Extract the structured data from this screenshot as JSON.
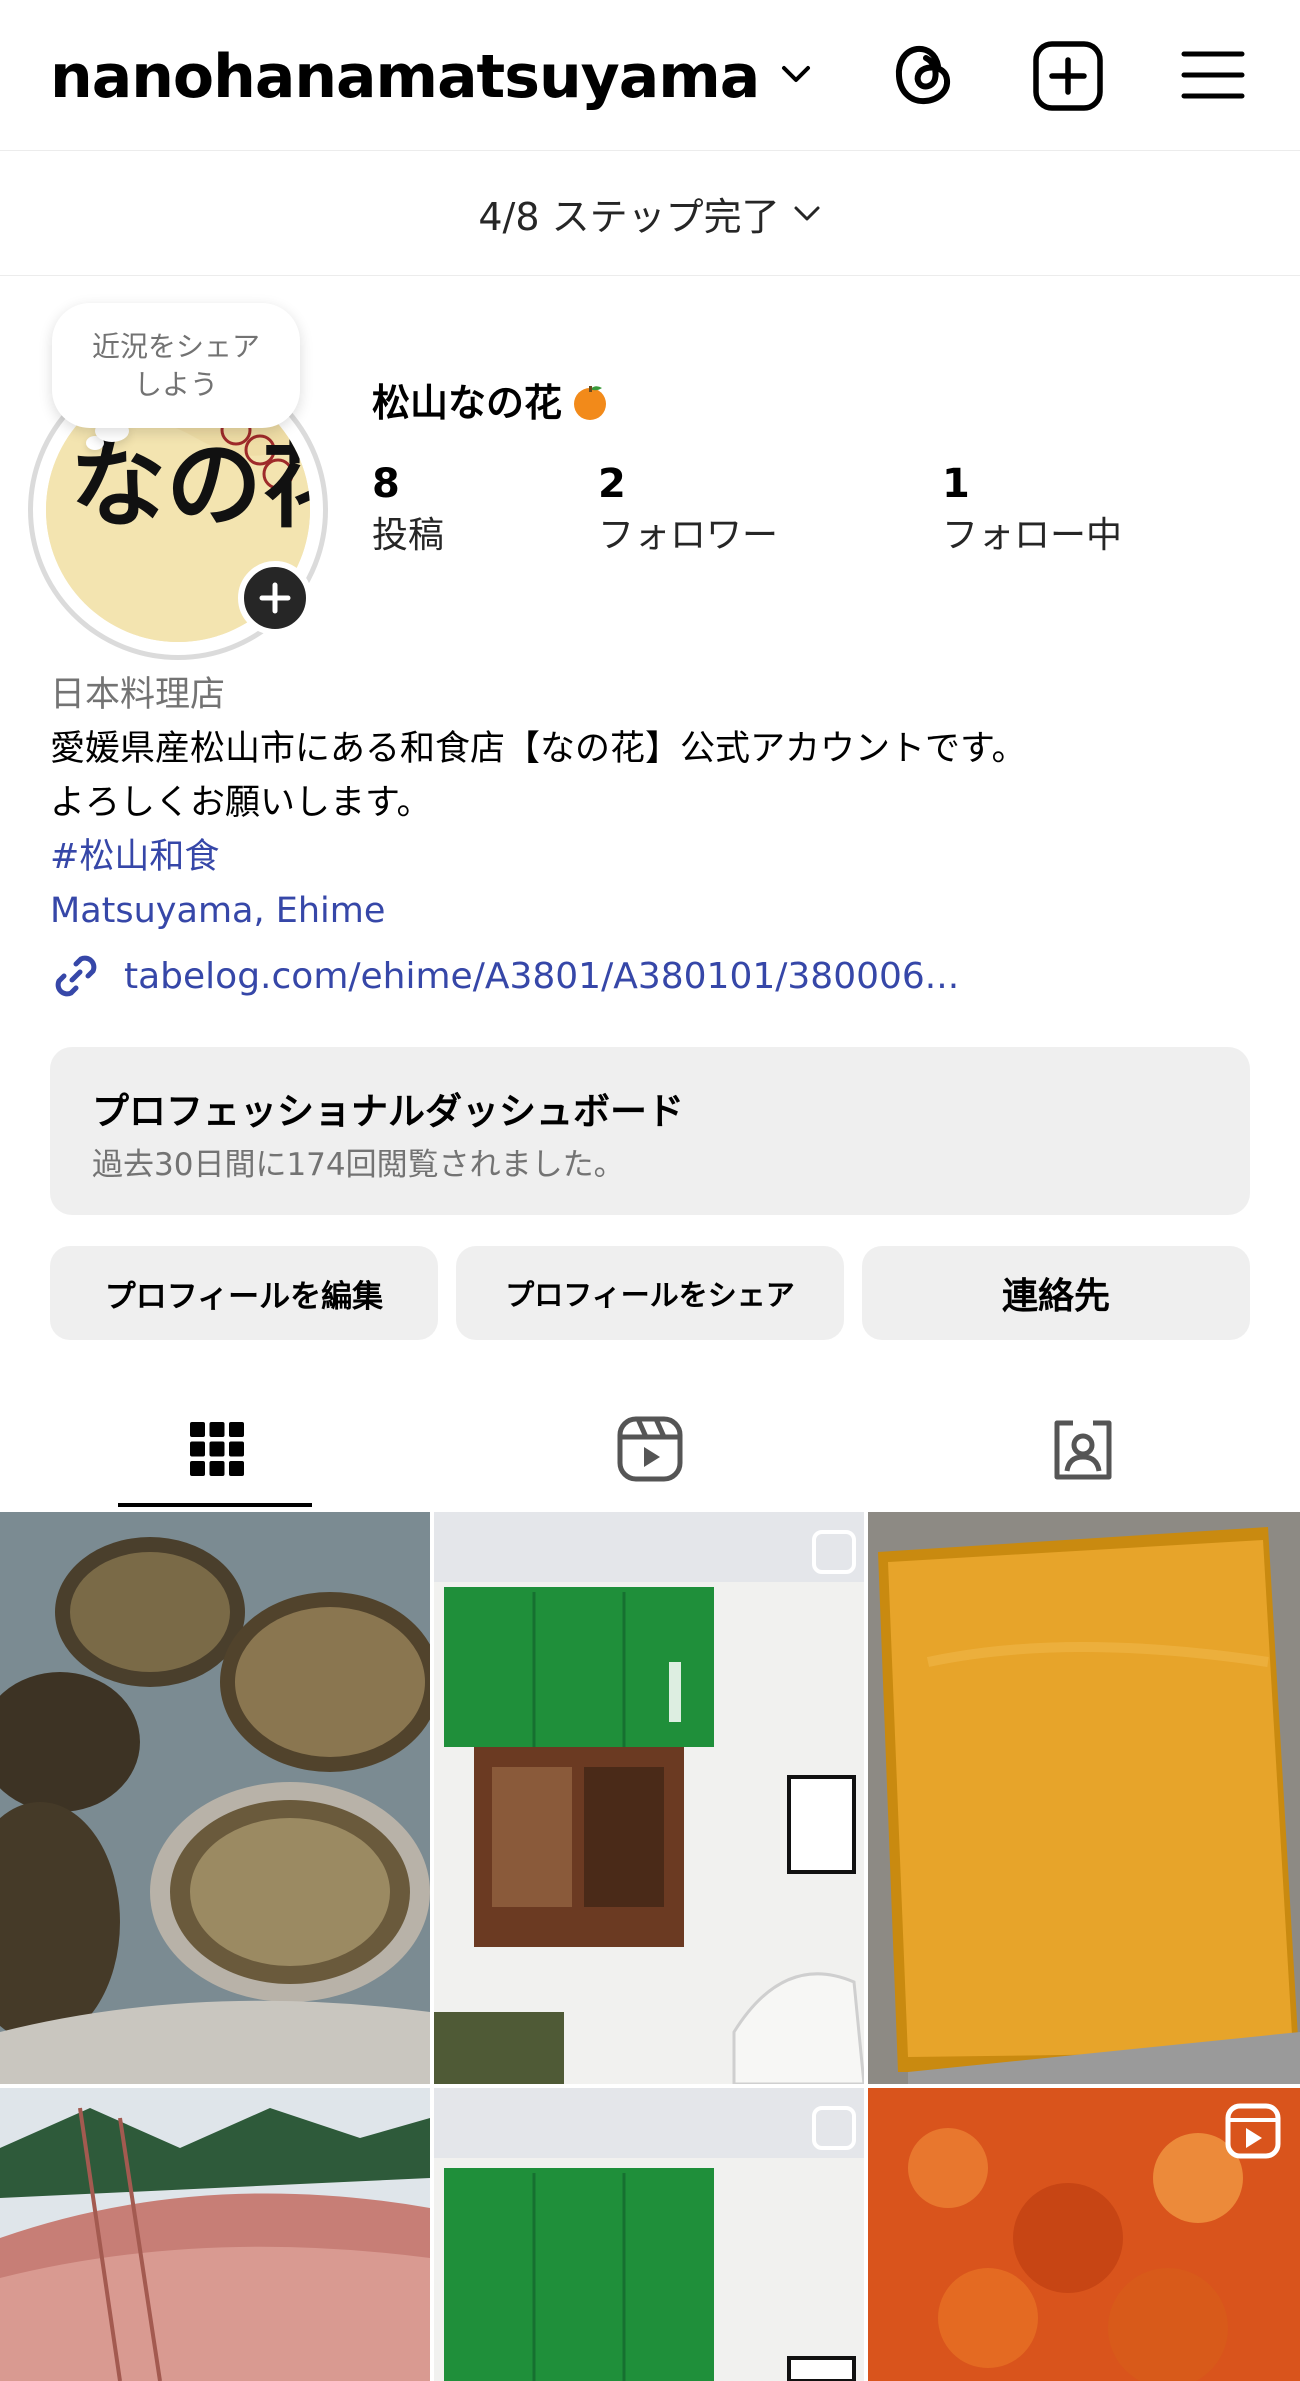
{
  "header": {
    "username": "nanohanamatsuyama",
    "icons": [
      "chevron-down-icon",
      "threads-icon",
      "new-post-icon",
      "menu-icon"
    ]
  },
  "steps": {
    "label": "4/8 ステップ完了"
  },
  "profile": {
    "bubble_text": "近況をシェア しよう",
    "display_name": "松山なの花",
    "stats": [
      {
        "value": "8",
        "label": "投稿"
      },
      {
        "value": "2",
        "label": "フォロワー"
      },
      {
        "value": "1",
        "label": "フォロー中"
      }
    ],
    "avatar_text": "なの花"
  },
  "bio": {
    "category": "日本料理店",
    "lines": [
      "愛媛県産松山市にある和食店【なの花】公式アカウントです。",
      "よろしくお願いします。"
    ],
    "hashtag": "#松山和食",
    "location": "Matsuyama, Ehime",
    "link": "tabelog.com/ehime/A3801/A380101/380006..."
  },
  "dashboard": {
    "title": "プロフェッショナルダッシュボード",
    "subtitle": "過去30日間に174回閲覧されました。"
  },
  "buttons": {
    "edit": "プロフィールを編集",
    "share": "プロフィールをシェア",
    "contact": "連絡先"
  },
  "tabs": [
    "grid-icon",
    "reels-icon",
    "tagged-icon"
  ],
  "grid": [
    {
      "subject": "abalone",
      "overlay": "none"
    },
    {
      "subject": "storefront-noren",
      "overlay": "carousel-icon"
    },
    {
      "subject": "orange-puree-tray",
      "overlay": "none"
    },
    {
      "subject": "sea-bream",
      "overlay": "none"
    },
    {
      "subject": "storefront-noren",
      "overlay": "carousel-icon"
    },
    {
      "subject": "orange-sauce",
      "overlay": "reels-icon"
    }
  ],
  "colors": {
    "link": "#3647a8",
    "button_bg": "#efefef",
    "muted": "#737373",
    "noren_green": "#1f8f3a"
  }
}
